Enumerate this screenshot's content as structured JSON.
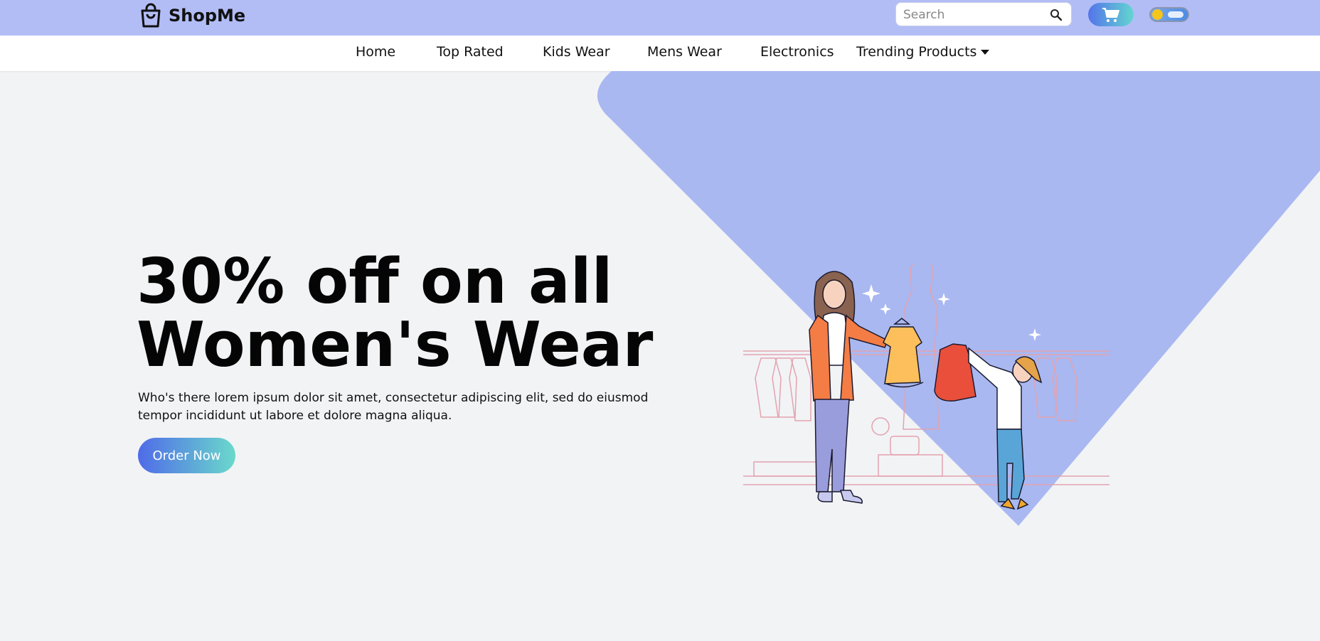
{
  "header": {
    "brand": "ShopMe",
    "search_placeholder": "Search",
    "search_value": "",
    "icons": {
      "logo": "shopping-bag-icon",
      "search": "search-icon",
      "cart": "cart-icon",
      "theme": "day-night-toggle"
    }
  },
  "nav": {
    "items": [
      {
        "label": "Home"
      },
      {
        "label": "Top Rated"
      },
      {
        "label": "Kids Wear"
      },
      {
        "label": "Mens Wear"
      },
      {
        "label": "Electronics"
      },
      {
        "label": "Trending Products"
      }
    ]
  },
  "hero": {
    "title": "30% off on all\nWomen's Wear",
    "description": "Who's there lorem ipsum dolor sit amet, consectetur adipiscing elit, sed do eiusmod tempor incididunt ut labore et dolore magna aliqua.",
    "cta_label": "Order Now",
    "illustration": "shopping-women-illustration"
  },
  "colors": {
    "header_bg": "#b2bdf6",
    "hero_shape": "#a9b8f1",
    "button_gradient_start": "#4f6be8",
    "button_gradient_end": "#6ad9cb"
  }
}
